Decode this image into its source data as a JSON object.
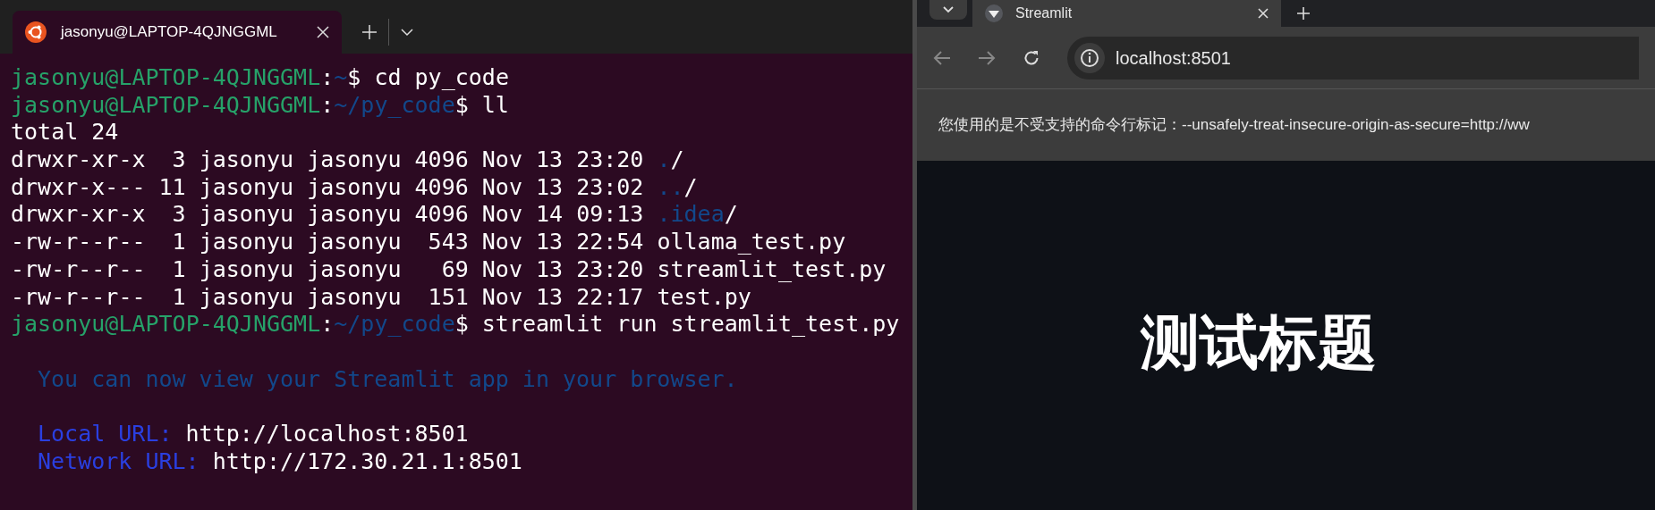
{
  "terminal": {
    "tab": {
      "title": "jasonyu@LAPTOP-4QJNGGML",
      "selected": true
    },
    "lines": [
      {
        "kind": "line",
        "indent": false,
        "segments": [
          {
            "kind": "user",
            "text": "jasonyu@LAPTOP-4QJNGGML"
          },
          {
            "kind": "plain",
            "text": ":"
          },
          {
            "kind": "path",
            "text": "~"
          },
          {
            "kind": "plain",
            "text": "$ cd py_code"
          }
        ]
      },
      {
        "kind": "line",
        "indent": false,
        "segments": [
          {
            "kind": "user",
            "text": "jasonyu@LAPTOP-4QJNGGML"
          },
          {
            "kind": "plain",
            "text": ":"
          },
          {
            "kind": "path",
            "text": "~/py_code"
          },
          {
            "kind": "plain",
            "text": "$ ll"
          }
        ]
      },
      {
        "kind": "line",
        "indent": false,
        "segments": [
          {
            "kind": "plain",
            "text": "total 24"
          }
        ]
      },
      {
        "kind": "line",
        "indent": false,
        "segments": [
          {
            "kind": "plain",
            "text": "drwxr-xr-x  3 jasonyu jasonyu 4096 Nov 13 23:20 "
          },
          {
            "kind": "dir",
            "text": "."
          },
          {
            "kind": "plain",
            "text": "/"
          }
        ]
      },
      {
        "kind": "line",
        "indent": false,
        "segments": [
          {
            "kind": "plain",
            "text": "drwxr-x--- 11 jasonyu jasonyu 4096 Nov 13 23:02 "
          },
          {
            "kind": "dir",
            "text": ".."
          },
          {
            "kind": "plain",
            "text": "/"
          }
        ]
      },
      {
        "kind": "line",
        "indent": false,
        "segments": [
          {
            "kind": "plain",
            "text": "drwxr-xr-x  3 jasonyu jasonyu 4096 Nov 14 09:13 "
          },
          {
            "kind": "dir",
            "text": ".idea"
          },
          {
            "kind": "plain",
            "text": "/"
          }
        ]
      },
      {
        "kind": "line",
        "indent": false,
        "segments": [
          {
            "kind": "plain",
            "text": "-rw-r--r--  1 jasonyu jasonyu  543 Nov 13 22:54 ollama_test.py"
          }
        ]
      },
      {
        "kind": "line",
        "indent": false,
        "segments": [
          {
            "kind": "plain",
            "text": "-rw-r--r--  1 jasonyu jasonyu   69 Nov 13 23:20 streamlit_test.py"
          }
        ]
      },
      {
        "kind": "line",
        "indent": false,
        "segments": [
          {
            "kind": "plain",
            "text": "-rw-r--r--  1 jasonyu jasonyu  151 Nov 13 22:17 test.py"
          }
        ]
      },
      {
        "kind": "line",
        "indent": false,
        "segments": [
          {
            "kind": "user",
            "text": "jasonyu@LAPTOP-4QJNGGML"
          },
          {
            "kind": "plain",
            "text": ":"
          },
          {
            "kind": "path",
            "text": "~/py_code"
          },
          {
            "kind": "plain",
            "text": "$ streamlit run streamlit_test.py"
          }
        ]
      },
      {
        "kind": "blank"
      },
      {
        "kind": "line",
        "indent": true,
        "segments": [
          {
            "kind": "notice",
            "text": "You can now view your Streamlit app in your browser."
          }
        ]
      },
      {
        "kind": "blank"
      },
      {
        "kind": "line",
        "indent": true,
        "segments": [
          {
            "kind": "label",
            "text": "Local URL:"
          },
          {
            "kind": "plain",
            "text": " http://localhost:8501"
          }
        ]
      },
      {
        "kind": "line",
        "indent": true,
        "segments": [
          {
            "kind": "label",
            "text": "Network URL:"
          },
          {
            "kind": "plain",
            "text": " http://172.30.21.1:8501"
          }
        ]
      }
    ]
  },
  "browser": {
    "tab": {
      "title": "Streamlit",
      "selected": true
    },
    "address": "localhost:8501",
    "infobar": "您使用的是不受支持的命令行标记：--unsafely-treat-insecure-origin-as-secure=http://ww",
    "page_title": "测试标题"
  }
}
